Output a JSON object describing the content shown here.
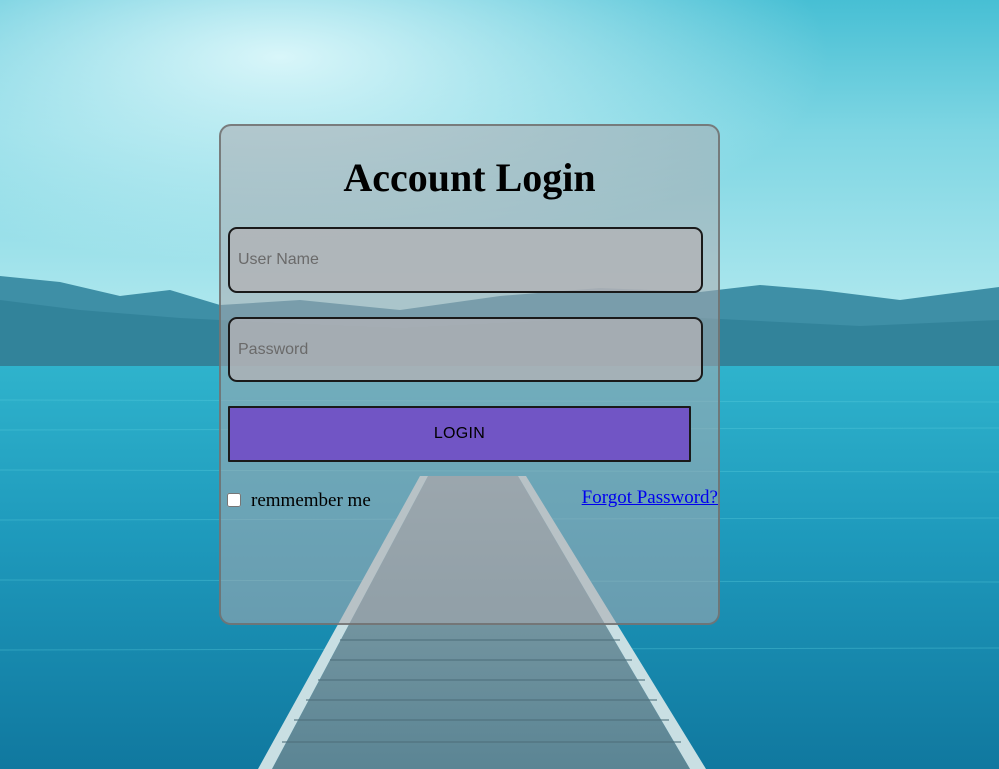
{
  "colors": {
    "card_background": "#aaaaaf",
    "login_button": "#7155c5",
    "link": "#0000ee",
    "sky_top": "#4fc2d6",
    "water": "#1c8fb0"
  },
  "login": {
    "title": "Account Login",
    "username_placeholder": "User Name",
    "password_placeholder": "Password",
    "login_label": "LOGIN",
    "remember_label": "remmember me",
    "remember_checked": false,
    "forgot_label": "Forgot Password?"
  },
  "background": {
    "icon": "lake-pier-landscape"
  }
}
